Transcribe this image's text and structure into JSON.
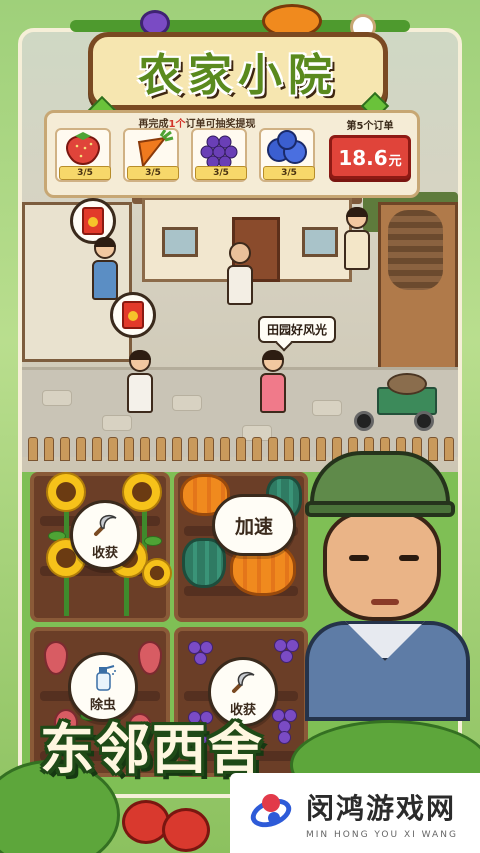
{
  "title": "农家小院",
  "orders": {
    "hint_before": "再完成",
    "hint_highlight": "1个",
    "hint_after": "订单可抽奖提现",
    "items": [
      {
        "name": "strawberry-icon",
        "progress": "3/5",
        "color": "#e0443a"
      },
      {
        "name": "carrot-icon",
        "progress": "3/5",
        "color": "#f07a1e"
      },
      {
        "name": "grapes-icon",
        "progress": "3/5",
        "color": "#6a3fb6"
      },
      {
        "name": "blueberry-icon",
        "progress": "3/5",
        "color": "#3b5fd0"
      }
    ],
    "order_count_label": "第5个订单",
    "price_value": "18.6",
    "price_unit": "元"
  },
  "scene": {
    "speech": "田园好风光"
  },
  "farm_actions": {
    "harvest_1": "收获",
    "speed_up": "加速",
    "pest": "除虫",
    "harvest_2": "收获"
  },
  "slogan": "东邻西舍",
  "watermark": {
    "name_cn": "闵鸿游戏网",
    "name_en": "MIN HONG YOU XI WANG"
  },
  "colors": {
    "accent_red": "#e0443a",
    "title_green": "#5a8a1e",
    "wood": "#7a4a22"
  }
}
